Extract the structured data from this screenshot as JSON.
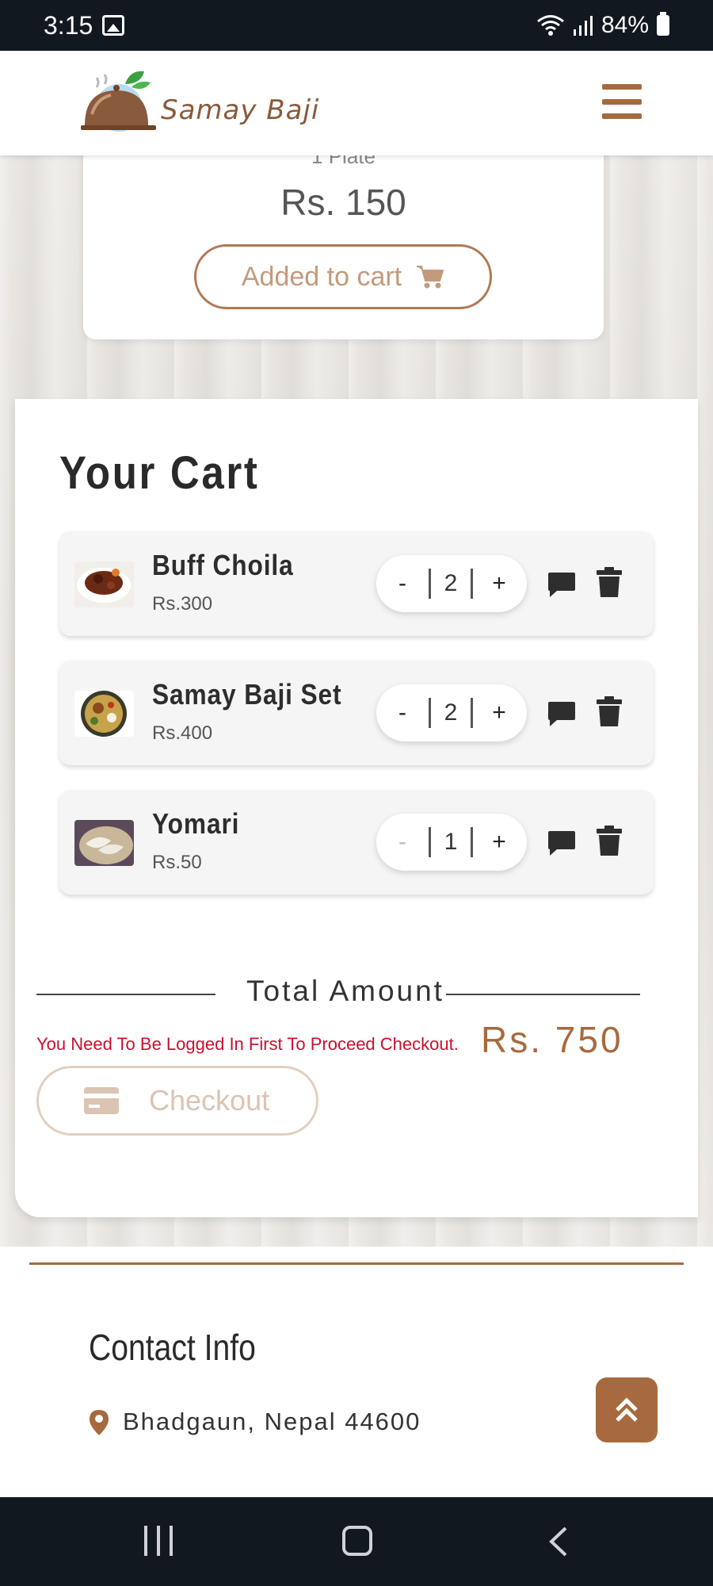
{
  "status_bar": {
    "time": "3:15",
    "battery": "84%"
  },
  "header": {
    "brand": "Samay Baji"
  },
  "product": {
    "qty_label": "1 Plate",
    "price": "Rs. 150",
    "added_label": "Added to cart"
  },
  "cart": {
    "title": "Your Cart",
    "items": [
      {
        "name": "Buff Choila",
        "price": "Rs.300",
        "qty": "2",
        "minus": "-",
        "plus": "+",
        "minus_disabled": false
      },
      {
        "name": "Samay Baji Set",
        "price": "Rs.400",
        "qty": "2",
        "minus": "-",
        "plus": "+",
        "minus_disabled": false
      },
      {
        "name": "Yomari",
        "price": "Rs.50",
        "qty": "1",
        "minus": "-",
        "plus": "+",
        "minus_disabled": true
      }
    ],
    "total_label": "Total Amount",
    "login_message": "You Need To Be Logged In First To Proceed Checkout.",
    "total_value": "Rs. 750",
    "checkout_label": "Checkout"
  },
  "footer": {
    "contact_title": "Contact Info",
    "address": "Bhadgaun, Nepal 44600"
  },
  "colors": {
    "accent": "#a66a3e",
    "error": "#c8102e",
    "system_bar": "#111820"
  },
  "icons": [
    "image-icon",
    "wifi-icon",
    "signal-icon",
    "battery-icon",
    "cart-icon",
    "comment-icon",
    "trash-icon",
    "credit-card-icon",
    "map-pin-icon",
    "double-chevron-up-icon",
    "menu-icon"
  ]
}
